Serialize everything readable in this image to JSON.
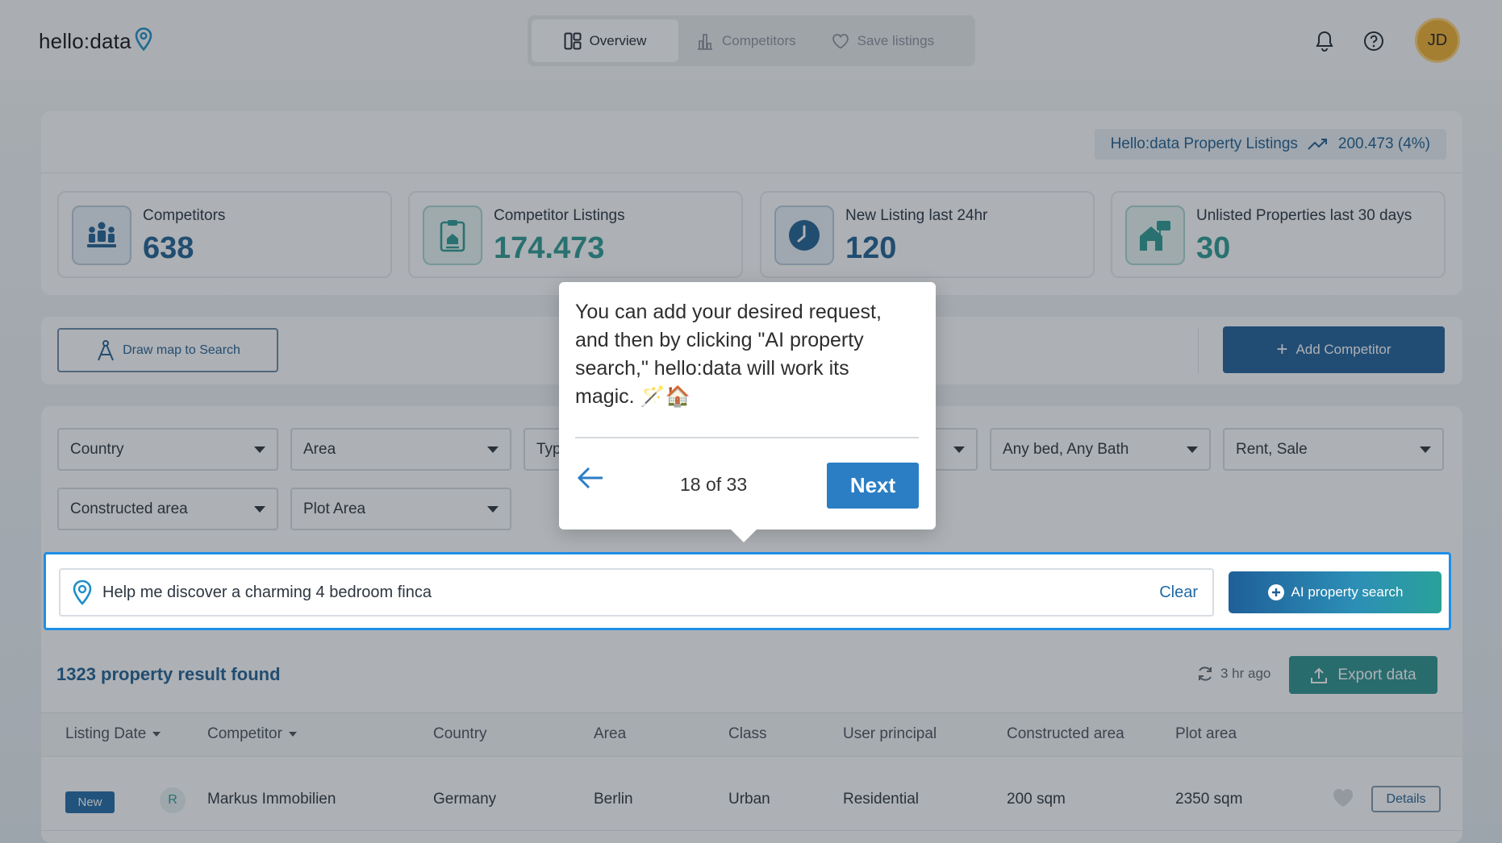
{
  "header": {
    "logo_text": "hello:data",
    "tabs": [
      {
        "label": "Overview",
        "icon": "layout-icon",
        "active": true
      },
      {
        "label": "Competitors",
        "icon": "bar-chart-icon",
        "active": false
      },
      {
        "label": "Save listings",
        "icon": "heart-icon",
        "active": false
      }
    ],
    "avatar_initials": "JD"
  },
  "stats": {
    "listing_pill": {
      "label": "Hello:data Property Listings",
      "value": "200.473 (4%)"
    },
    "cards": [
      {
        "label": "Competitors",
        "value": "638",
        "icon": "people-icon"
      },
      {
        "label": "Competitor Listings",
        "value": "174.473",
        "icon": "clipboard-icon"
      },
      {
        "label": "New Listing last 24hr",
        "value": "120",
        "icon": "clock-icon"
      },
      {
        "label": "Unlisted Properties last 30 days",
        "value": "30",
        "icon": "house-sign-icon"
      }
    ]
  },
  "actions": {
    "draw_map_label": "Draw map to Search",
    "add_competitor_label": "Add Competitor"
  },
  "filters": {
    "country": "Country",
    "area": "Area",
    "type": "Typ",
    "beds_baths": "Any bed, Any Bath",
    "rent_sale": "Rent, Sale",
    "constructed_area": "Constructed area",
    "plot_area": "Plot Area"
  },
  "search": {
    "value": "Help me discover a charming 4 bedroom finca",
    "clear_label": "Clear",
    "ai_button_label": "AI property search"
  },
  "results": {
    "title": "1323 property result found",
    "refreshed": "3 hr ago",
    "export_label": "Export data",
    "columns": [
      "Listing Date",
      "Competitor",
      "Country",
      "Area",
      "Class",
      "User principal",
      "Constructed area",
      "Plot area"
    ],
    "rows": [
      {
        "badge": "New",
        "competitor_initial": "R",
        "competitor": "Markus Immobilien",
        "country": "Germany",
        "area": "Berlin",
        "class": "Urban",
        "user_principal": "Residential",
        "constructed_area": "200 sqm",
        "plot_area": "2350 sqm",
        "details_label": "Details"
      }
    ]
  },
  "tour": {
    "text": "You can add your desired request, and then by clicking \"AI property search,\" hello:data will work its magic. 🪄🏠",
    "step": "18 of 33",
    "next_label": "Next"
  },
  "colors": {
    "brand_blue": "#1e5f99",
    "teal": "#2a928f",
    "highlight": "#1f8fe6",
    "avatar": "#f2b02d"
  }
}
